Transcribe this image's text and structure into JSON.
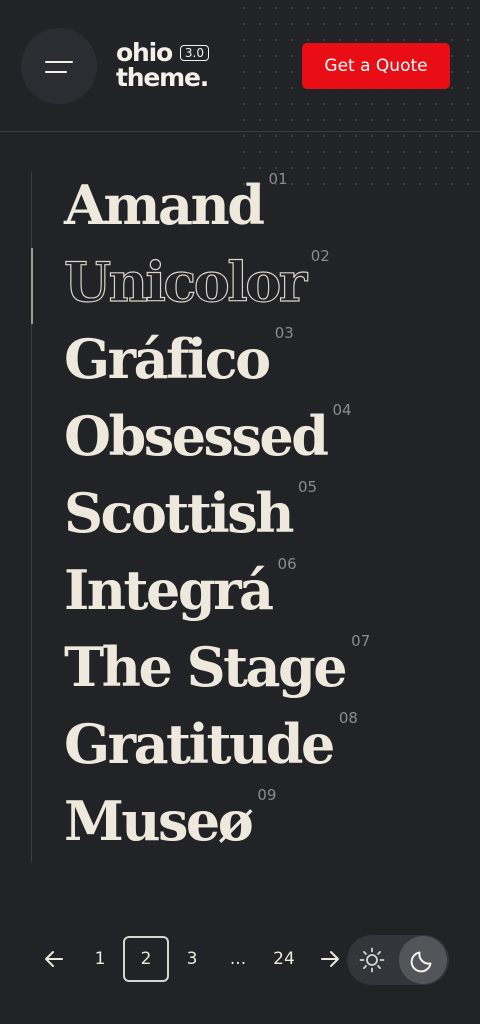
{
  "header": {
    "menu_icon": "hamburger-icon",
    "logo": {
      "line1": "ohio",
      "line2": "theme.",
      "version": "3.0"
    },
    "cta_label": "Get a Quote",
    "cta_color": "#e90d16"
  },
  "portfolio": {
    "items": [
      {
        "title": "Amand",
        "number": "01"
      },
      {
        "title": "Unicolor",
        "number": "02"
      },
      {
        "title": "Gráfico",
        "number": "03"
      },
      {
        "title": "Obsessed",
        "number": "04"
      },
      {
        "title": "Scottish",
        "number": "05"
      },
      {
        "title": "Integrá",
        "number": "06"
      },
      {
        "title": "The Stage",
        "number": "07"
      },
      {
        "title": "Gratitude",
        "number": "08"
      },
      {
        "title": "Museø",
        "number": "09"
      }
    ],
    "active_index": 1
  },
  "pagination": {
    "prev_icon": "arrow-left-icon",
    "next_icon": "arrow-right-icon",
    "pages": [
      "1",
      "2",
      "3",
      "...",
      "24"
    ],
    "current": "2"
  },
  "theme_toggle": {
    "light_icon": "sun-icon",
    "dark_icon": "moon-icon",
    "mode": "dark"
  },
  "colors": {
    "background": "#222327",
    "text": "#efe8dc",
    "accent": "#e90d16"
  }
}
